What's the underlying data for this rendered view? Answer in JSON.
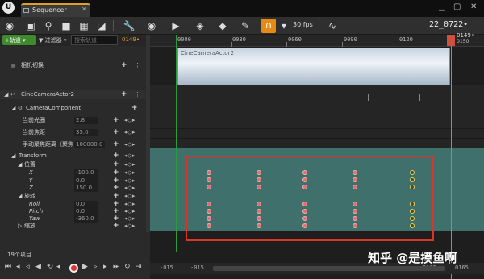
{
  "window": {
    "tab_title": "Sequencer",
    "logo": "U"
  },
  "toolbar": {
    "fps": "30 fps",
    "timecode": "22_0722•",
    "icons": [
      "save-icon",
      "browse-icon",
      "camera-icon",
      "film-icon",
      "render-icon",
      "wrench-icon",
      "eye-icon",
      "play-icon",
      "unreal-icon",
      "tag-icon",
      "curve-icon",
      "magnet-icon",
      "graph-icon"
    ]
  },
  "leftpanel": {
    "track_button": "+轨道 ▾",
    "filter_button": "▼ 过滤器 ▾",
    "search_placeholder": "搜索轨道",
    "frame_count": "0149•",
    "camera_cut": "相机切换",
    "actor": "CineCameraActor2",
    "component": "CameraComponent",
    "props": [
      {
        "label": "当前光圈",
        "value": "2.8"
      },
      {
        "label": "当前焦距",
        "value": "35.0"
      },
      {
        "label": "手动聚焦距离（聚焦",
        "value": "100000.0"
      }
    ],
    "transform": "Transform",
    "location": "位置",
    "loc": [
      {
        "label": "X",
        "value": "-100.0"
      },
      {
        "label": "Y",
        "value": "0.0"
      },
      {
        "label": "Z",
        "value": "150.0"
      }
    ],
    "rotation": "旋转",
    "rot": [
      {
        "label": "Roll",
        "value": "0.0"
      },
      {
        "label": "Pitch",
        "value": "0.0"
      },
      {
        "label": "Yaw",
        "value": "-360.0"
      }
    ],
    "scale": "缩放",
    "status": "19个项目"
  },
  "timeline": {
    "ticks": [
      "0000",
      "0030",
      "0060",
      "0090",
      "0120"
    ],
    "playhead": "0149•",
    "playhead_sub": "0150",
    "thumbnail_label": "CineCameraActor2",
    "bottom_left": [
      "-015",
      "-015"
    ],
    "bottom_right": [
      "0165",
      "0165"
    ]
  },
  "watermark": "知乎 @是摸鱼啊"
}
